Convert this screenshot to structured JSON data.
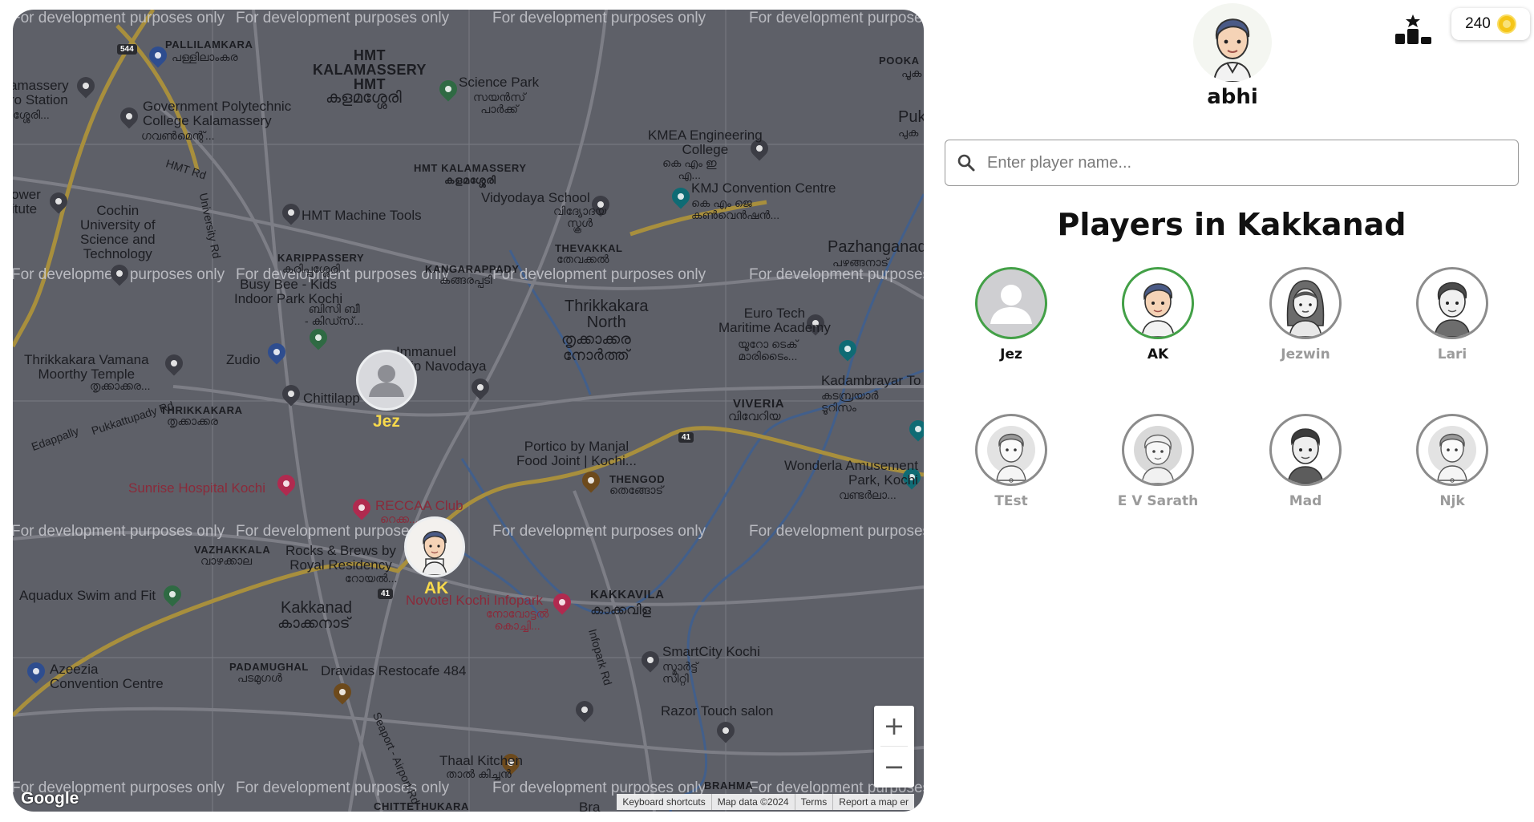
{
  "user": {
    "name": "abhi",
    "avatar_icon": "user-avatar-icon"
  },
  "coins": {
    "amount": "240",
    "icon": "coin-icon"
  },
  "leaderboard": {
    "icon": "podium-star-icon"
  },
  "search": {
    "placeholder": "Enter player name..."
  },
  "players_heading": "Players in Kakkanad",
  "players": [
    {
      "name": "Jez",
      "online": true,
      "avatar": "default-person-icon"
    },
    {
      "name": "AK",
      "online": true,
      "avatar": "man-avatar-icon"
    },
    {
      "name": "Jezwin",
      "online": false,
      "avatar": "woman-avatar-icon"
    },
    {
      "name": "Lari",
      "online": false,
      "avatar": "man-avatar-icon"
    },
    {
      "name": "TEst",
      "online": false,
      "avatar": "man-avatar-icon"
    },
    {
      "name": "E V Sarath",
      "online": false,
      "avatar": "elder-avatar-icon"
    },
    {
      "name": "Mad",
      "online": false,
      "avatar": "man-avatar-icon"
    },
    {
      "name": "Njk",
      "online": false,
      "avatar": "man-avatar-icon"
    }
  ],
  "map": {
    "watermark": "For development purposes only",
    "markers": [
      {
        "name": "Jez"
      },
      {
        "name": "AK"
      }
    ],
    "labels": {
      "pallilamkara": "PALLILAMKARA",
      "pallilamkara_ml": "പള്ളിലാംകര",
      "hmt": "HMT\nKALAMASSERY\nHMT",
      "hmt_ml": "കളമശ്ശേരി",
      "science_park": "Science Park",
      "science_park_ml": "സയൻസ്\nപാർക്ക്",
      "pooka": "POOKA",
      "pooka_ml": "പൂക",
      "puk": "Puk",
      "puk_ml": "പുക",
      "station": "amassery\nro Station",
      "station_ml": "ശ്ശേരി...",
      "gov_poly": "Government Polytechnic\nCollege Kalamassery",
      "gov_poly_ml": "ഗവൺമെന്റ്...",
      "kmea": "KMEA Engineering\nCollege",
      "kmea_ml": "കെ എം ഇ\nഎ...",
      "hmt_rd": "HMT Rd",
      "kalam_ml": "HMT KALAMASSERY\nകളമശ്ശേരി",
      "vidyodaya": "Vidyodaya School",
      "vidyodaya_ml": "വിദ്യോദയ\nസ്കൂൾ",
      "kmj": "KMJ Convention Centre",
      "kmj_ml": "കെ എം ജെ\nകൺവെൻഷൻ...",
      "cusat": "Cochin\nUniversity of\nScience and\nTechnology",
      "power": "ower\nitute",
      "hmt_machine": "HMT Machine Tools",
      "univ_rd": "University Rd",
      "karippassery": "KARIPPASSERY",
      "karippassery_ml": "കരിപ്പശ്ശേരി",
      "thevakkal": "THEVAKKAL",
      "thevakkal_ml": "തേവക്കൽ",
      "pazhanganad": "Pazhanganad",
      "pazhanganad_ml": "പഴങ്ങനാട്",
      "kangarappady": "KANGARAPPADY",
      "kangarappady_ml": "കങ്ങരപ്പടി",
      "busy_bee": "Busy Bee - Kids\nIndoor Park Kochi",
      "busy_bee_ml": "ബിസി ബീ\n- കിഡ്സ്...",
      "thrikkakara_north": "Thrikkakara\nNorth",
      "thrikkakara_north_ml": "തൃക്കാക്കര\nനോർത്ത്",
      "eurotech": "Euro Tech\nMaritime Academy",
      "eurotech_ml": "യൂറോ ടെക്\nമാരിടൈം...",
      "zudio": "Zudio",
      "immanuel": "Immanuel\nship Navodaya",
      "chittilapp": "Chittilapp",
      "vamana": "Thrikkakara Vamana\nMoorthy Temple",
      "vamana_ml": "തൃക്കാക്കര...",
      "kadambrayar": "Kadambrayar To",
      "kadambrayar_ml": "കടമ്പ്രയാർ\nടൂറിസം",
      "thrikkakara": "THRIKKAKARA",
      "thrikkakara_ml": "തൃക്കാക്കര",
      "viveria": "VIVERIA",
      "viveria_ml": "വിവേറിയ",
      "pukkattupady": "Pukkattupady Rd",
      "edappally": "Edappally",
      "portico": "Portico by Manjal\nFood Joint | Kochi...",
      "sunrise": "Sunrise Hospital Kochi",
      "thengod": "THENGOD",
      "thengod_ml": "തെങ്ങോട്",
      "wonderla": "Wonderla Amusement\nPark, Kochi",
      "wonderla_ml": "വണ്ടർലാ...",
      "reccaa": "RECCAA Club",
      "reccaa_ml": "റെക്ക...",
      "vazhakkala": "VAZHAKKALA",
      "vazhakkala_ml": "വാഴക്കാല",
      "rocks": "Rocks & Brews by\nRoyal Residency",
      "rocks_ml": "റോയൽ...",
      "aquadux": "Aquadux Swim and Fit",
      "kakkanad": "Kakkanad",
      "kakkanad_ml": "കാക്കനാട്",
      "novotel": "Novotel Kochi Infopark",
      "novotel_ml": "നോവോട്ടൽ\nകൊച്ചി...",
      "kakkavila": "KAKKAVILA",
      "kakkavila_ml": "കാക്കവിള",
      "infopark_rd": "Infopark Rd",
      "smartcity": "SmartCity Kochi",
      "smartcity_ml": "സ്മാർട്ട്\nസിറ്റി",
      "azeezia": "Azeezia\nConvention Centre",
      "padamughal": "PADAMUGHAL",
      "padamughal_ml": "പടമുഗൾ",
      "dravidas": "Dravidas Restocafe 484",
      "razor": "Razor Touch salon",
      "seaport": "Seaport - Airport Rd",
      "thaal": "Thaal Kitchen",
      "thaal_ml": "താൽ കിച്ചൻ",
      "brahma": "BRAHMA",
      "chittethukara": "CHITTETHUKARA",
      "bra": "Bra"
    },
    "road_shields": [
      "544",
      "41",
      "41"
    ],
    "zoom_in": "+",
    "zoom_out": "−",
    "google_logo": "Google",
    "attribution": [
      "Keyboard shortcuts",
      "Map data ©2024",
      "Terms",
      "Report a map er"
    ]
  }
}
